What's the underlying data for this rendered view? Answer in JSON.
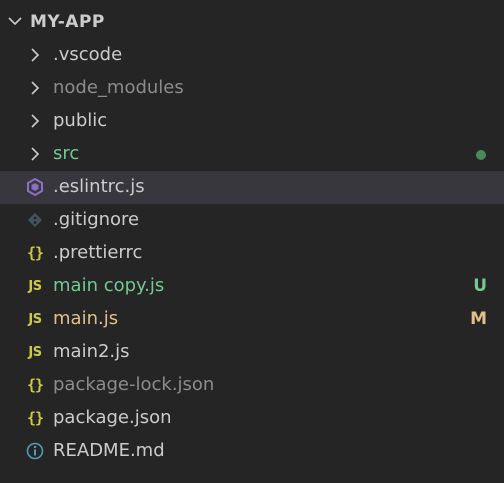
{
  "explorer": {
    "section_title": "MY-APP",
    "colors": {
      "background": "#252526",
      "selected_row": "#37373d",
      "untracked": "#73c991",
      "modified": "#e2c08d",
      "ignored": "#8c8c8c",
      "default_text": "#cccccc",
      "js_icon": "#cbcb41",
      "eslint_icon": "#8c6fc0",
      "git_icon": "#41535b",
      "info_icon": "#519aba"
    },
    "items": [
      {
        "label": ".vscode",
        "type": "folder",
        "icon": "chevron-right-icon"
      },
      {
        "label": "node_modules",
        "type": "folder",
        "icon": "chevron-right-icon",
        "state": "ignored"
      },
      {
        "label": "public",
        "type": "folder",
        "icon": "chevron-right-icon"
      },
      {
        "label": "src",
        "type": "folder",
        "icon": "chevron-right-icon",
        "state": "untracked",
        "decoration": "dot"
      },
      {
        "label": ".eslintrc.js",
        "type": "file",
        "icon": "eslint-icon",
        "selected": true
      },
      {
        "label": ".gitignore",
        "type": "file",
        "icon": "git-icon"
      },
      {
        "label": ".prettierrc",
        "type": "file",
        "icon": "json-braces-icon"
      },
      {
        "label": "main copy.js",
        "type": "file",
        "icon": "javascript-icon",
        "state": "untracked",
        "badge": "U"
      },
      {
        "label": "main.js",
        "type": "file",
        "icon": "javascript-icon",
        "state": "modified",
        "badge": "M"
      },
      {
        "label": "main2.js",
        "type": "file",
        "icon": "javascript-icon"
      },
      {
        "label": "package-lock.json",
        "type": "file",
        "icon": "json-braces-icon",
        "state": "ignored"
      },
      {
        "label": "package.json",
        "type": "file",
        "icon": "json-braces-icon"
      },
      {
        "label": "README.md",
        "type": "file",
        "icon": "info-icon"
      }
    ]
  }
}
